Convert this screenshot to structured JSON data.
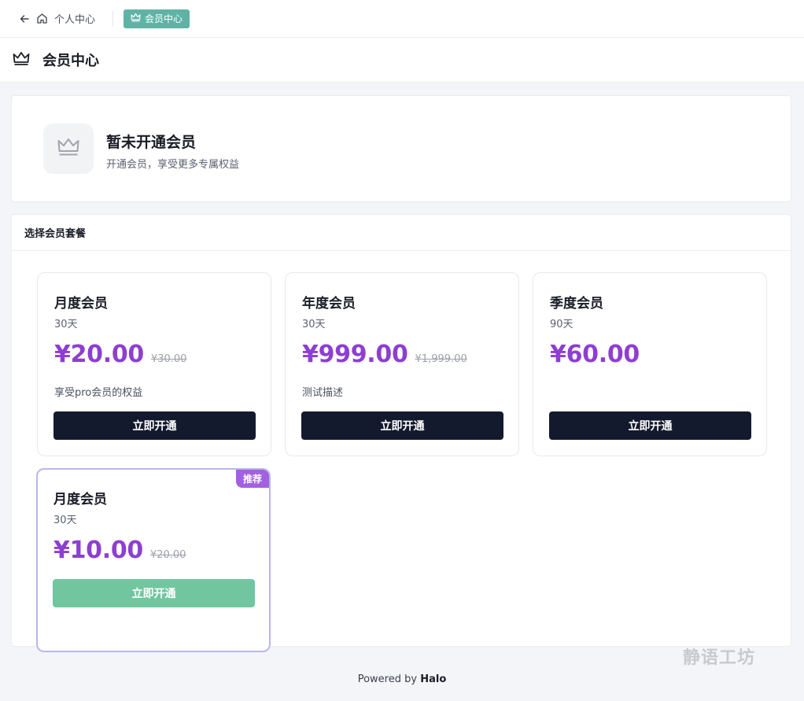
{
  "breadcrumb": {
    "back_label": "个人中心",
    "current_label": "会员中心"
  },
  "header": {
    "title": "会员中心"
  },
  "status": {
    "title": "暂未开通会员",
    "subtitle": "开通会员，享受更多专属权益"
  },
  "plans_section": {
    "title": "选择会员套餐"
  },
  "plans": [
    {
      "name": "月度会员",
      "days": "30天",
      "price": "¥20.00",
      "original": "¥30.00",
      "desc": "享受pro会员的权益",
      "button": "立即开通"
    },
    {
      "name": "年度会员",
      "days": "30天",
      "price": "¥999.00",
      "original": "¥1,999.00",
      "desc": "测试描述",
      "button": "立即开通"
    },
    {
      "name": "季度会员",
      "days": "90天",
      "price": "¥60.00",
      "original": "",
      "desc": "",
      "button": "立即开通"
    },
    {
      "name": "月度会员",
      "days": "30天",
      "price": "¥10.00",
      "original": "¥20.00",
      "desc": "",
      "button": "立即开通",
      "badge": "推荐"
    }
  ],
  "footer": {
    "prefix": "Powered by",
    "brand": "Halo"
  },
  "watermark": "静语工坊",
  "colors": {
    "price": "#8d3fd1",
    "button_dark": "#141a2e",
    "button_featured": "#71c6a0",
    "tag_active": "#5fb3a5",
    "badge": "#a261df"
  },
  "icons": {
    "back": "arrow-left-icon",
    "home": "home-icon",
    "crown": "crown-icon"
  }
}
